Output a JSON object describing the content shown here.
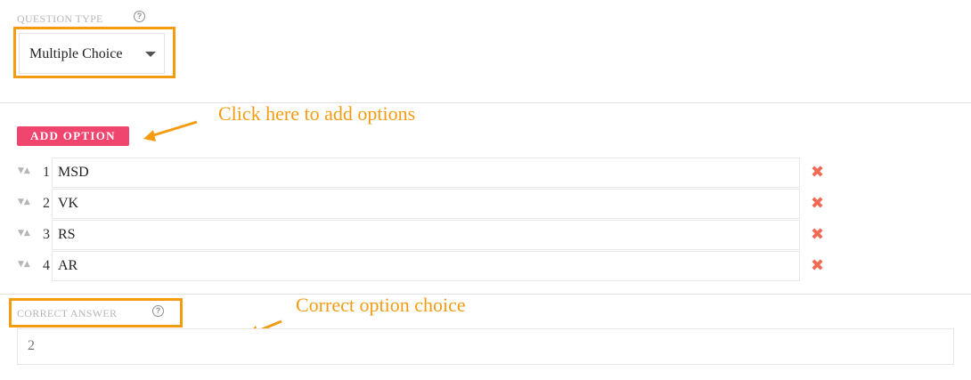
{
  "question_type": {
    "label": "QUESTION TYPE",
    "help_icon": "?",
    "selected": "Multiple Choice"
  },
  "add_option": {
    "label": "ADD OPTION"
  },
  "annotations": {
    "add_hint": "Click here to add options",
    "correct_hint": "Correct option choice"
  },
  "options": [
    {
      "number": "1",
      "value": "MSD"
    },
    {
      "number": "2",
      "value": "VK"
    },
    {
      "number": "3",
      "value": "RS"
    },
    {
      "number": "4",
      "value": "AR"
    }
  ],
  "sort_icon_glyph": "▼▲",
  "delete_icon_glyph": "✖",
  "correct_answer": {
    "label": "CORRECT ANSWER",
    "help_icon": "?",
    "value": "2"
  },
  "colors": {
    "accent_orange": "#f39c12",
    "add_button": "#f0456f",
    "delete_icon": "#ef6b53"
  }
}
